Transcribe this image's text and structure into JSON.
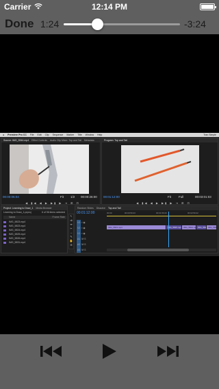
{
  "status_bar": {
    "carrier": "Carrier",
    "time": "12:14 PM",
    "icons": [
      "wifi-icon",
      "battery-icon"
    ]
  },
  "player": {
    "done_label": "Done",
    "elapsed": "1:24",
    "remaining": "-3:24",
    "progress": 0.29,
    "controls": [
      "previous-track-icon",
      "play-icon",
      "next-track-icon"
    ]
  },
  "video_frame": {
    "menu_bar": {
      "app": "Premiere Pro CC",
      "items": [
        "File",
        "Edit",
        "Clip",
        "Sequence",
        "Marker",
        "Title",
        "Window",
        "Help"
      ],
      "user": "Tran Simple"
    },
    "source_monitor": {
      "tabs": [
        "Source: IMG_5344.mp4",
        "Effect Controls",
        "Audio Clip Mixer: Top and Tail",
        "Metadata"
      ],
      "timecode_left": "00:00:05:04",
      "fit": "Fit",
      "ratio": "1/2",
      "timecode_right": "00:00:26:00"
    },
    "program_monitor": {
      "tabs": [
        "Program: Top and Tail"
      ],
      "timecode_left": "00:01:12:00",
      "fit": "Fit",
      "ratio": "Full",
      "timecode_right": "00:03:01:03"
    },
    "project_panel": {
      "tabs": [
        "Project: Learning to Draw_1",
        "Media Browser"
      ],
      "name": "Learning to Draw_1.prproj",
      "count": "6 of 96 items selected",
      "columns": [
        "Name",
        "Frame Rate"
      ],
      "rows": [
        "IMG_5823.mp4",
        "IMG_5823.mp4",
        "IMG_5824.mp4",
        "IMG_5825.mp4",
        "IMG_5826.mp4",
        "IMG_5831.mp4"
      ]
    },
    "timeline": {
      "tabs": [
        "Random Slides",
        "Dissolve",
        "Top and Tail"
      ],
      "timecode": "00:01:12:00",
      "ruler": [
        "00:00",
        "00:00:59:23",
        "00:01:59:23",
        "00:02:59:22"
      ],
      "tracks": [
        "V3",
        "V2",
        "V1",
        "A1",
        "A2",
        "A3"
      ],
      "clips": [
        "IMG_5823.mp4",
        "IMG_5825.mp4",
        "IMG_5824.mp4",
        "IMG_5825.mp4",
        "IMG_5826.mp4"
      ]
    }
  }
}
